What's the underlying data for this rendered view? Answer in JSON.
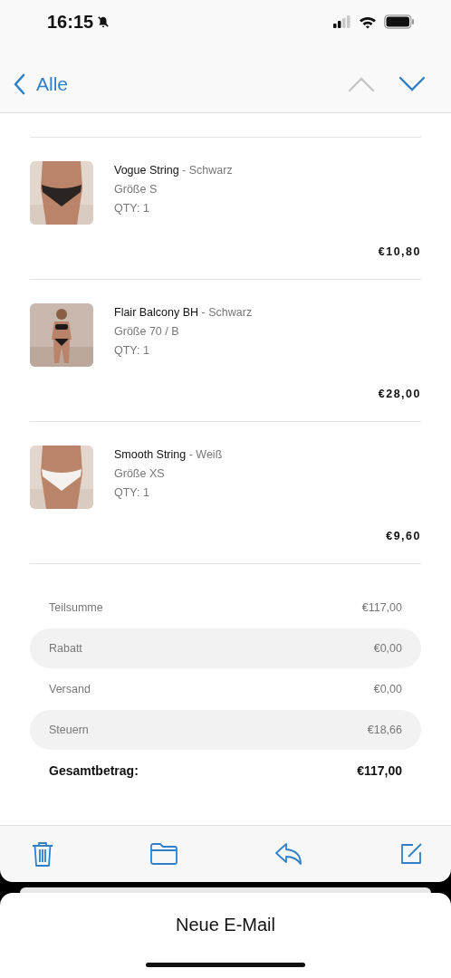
{
  "status_bar": {
    "time": "16:15"
  },
  "nav": {
    "back_label": "Alle",
    "previous_disabled": true,
    "next_disabled": false
  },
  "items": [
    {
      "name": "Vogue String",
      "variant": "- Schwarz",
      "size": "Größe S",
      "qty": "QTY: 1",
      "price": "€10,80"
    },
    {
      "name": "Flair Balcony BH",
      "variant": "- Schwarz",
      "size": "Größe 70 / B",
      "qty": "QTY: 1",
      "price": "€28,00"
    },
    {
      "name": "Smooth String",
      "variant": "- Weiß",
      "size": "Größe XS",
      "qty": "QTY: 1",
      "price": "€9,60"
    }
  ],
  "summary": [
    {
      "kind": "line",
      "label": "Teilsumme",
      "value": "€117,00"
    },
    {
      "kind": "line",
      "label": "Rabatt",
      "value": "€0,00"
    },
    {
      "kind": "line",
      "label": "Versand",
      "value": "€0,00"
    },
    {
      "kind": "line",
      "label": "Steuern",
      "value": "€18,66"
    },
    {
      "kind": "total",
      "label": "Gesamtbetrag:",
      "value": "€117,00"
    }
  ],
  "sheet": {
    "title": "Neue E-Mail"
  }
}
